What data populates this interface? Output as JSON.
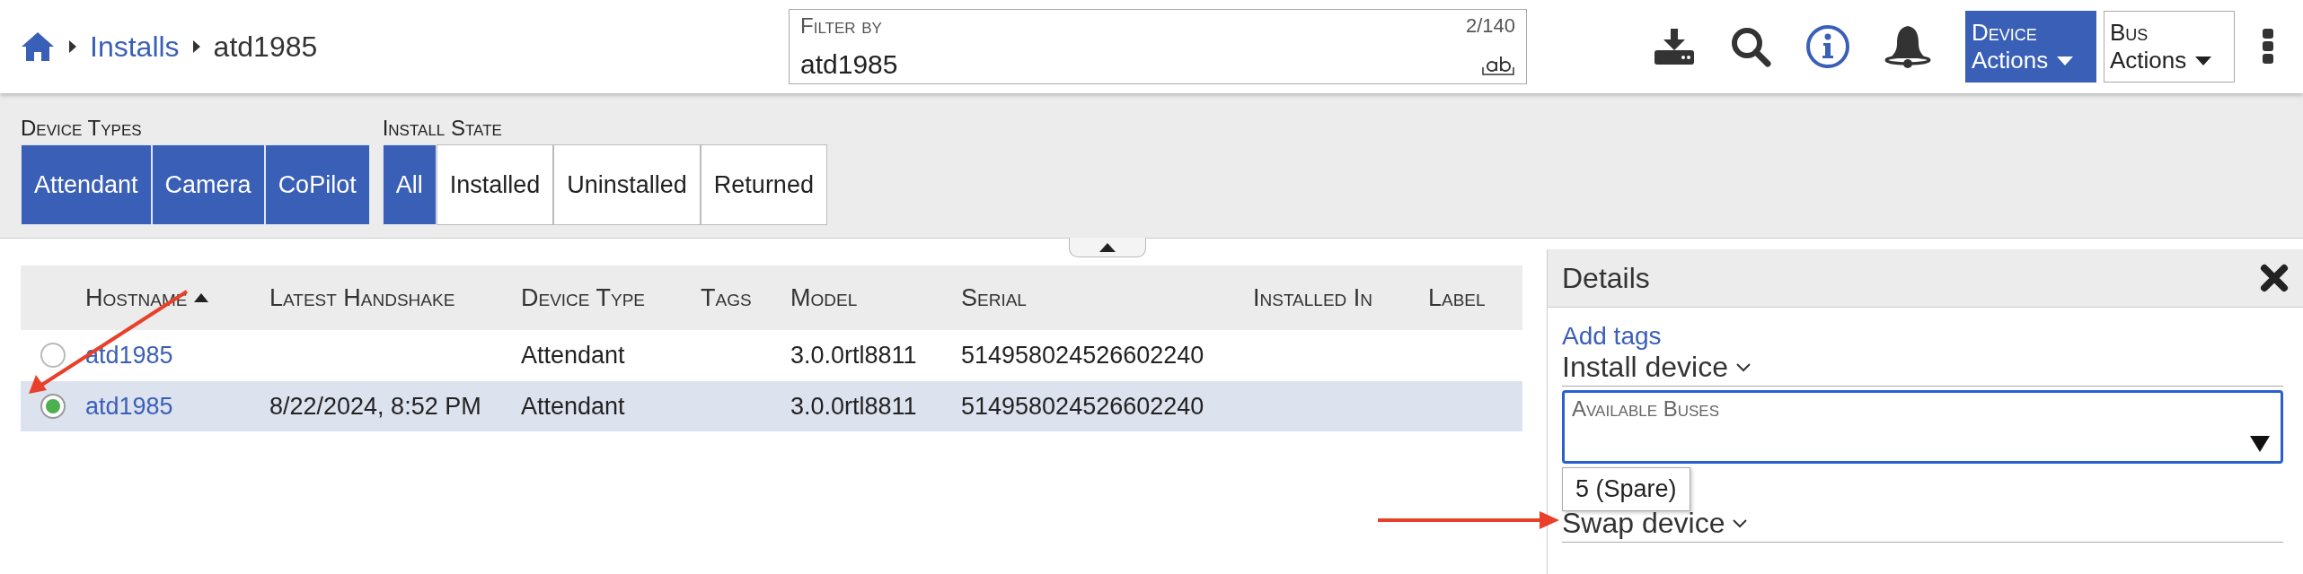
{
  "breadcrumb": [
    {
      "label": "Installs",
      "kind": "link"
    },
    {
      "label": "atd1985",
      "kind": "current"
    }
  ],
  "filter": {
    "label": "Filter by",
    "count": "2/140",
    "value": "atd1985"
  },
  "action_buttons": [
    {
      "line1": "Device",
      "line2": "Actions",
      "kind": "primary"
    },
    {
      "line1": "Bus",
      "line2": "Actions",
      "kind": "secondary"
    }
  ],
  "filter_groups": [
    {
      "label": "Device Types",
      "options": [
        {
          "label": "Attendant",
          "selected": true
        },
        {
          "label": "Camera",
          "selected": true
        },
        {
          "label": "CoPilot",
          "selected": true
        }
      ]
    },
    {
      "label": "Install State",
      "options": [
        {
          "label": "All",
          "selected": true
        },
        {
          "label": "Installed",
          "selected": false
        },
        {
          "label": "Uninstalled",
          "selected": false
        },
        {
          "label": "Returned",
          "selected": false
        }
      ]
    }
  ],
  "table": {
    "columns": [
      {
        "label": "Hostname",
        "sorted": true
      },
      {
        "label": "Latest Handshake",
        "sorted": false
      },
      {
        "label": "Device Type",
        "sorted": false
      },
      {
        "label": "Tags",
        "sorted": false
      },
      {
        "label": "Model",
        "sorted": false
      },
      {
        "label": "Serial",
        "sorted": false
      },
      {
        "label": "Installed In",
        "sorted": false
      },
      {
        "label": "Label",
        "sorted": false
      }
    ],
    "rows": [
      {
        "selected": false,
        "cells": [
          "atd1985",
          null,
          "Attendant",
          null,
          "3.0.0rtl8811",
          "514958024526602240",
          null,
          null
        ]
      },
      {
        "selected": true,
        "cells": [
          "atd1985",
          "8/22/2024, 8:52 PM",
          "Attendant",
          null,
          "3.0.0rtl8811",
          "514958024526602240",
          null,
          null
        ]
      }
    ]
  },
  "details": {
    "title": "Details",
    "add_tags": "Add tags",
    "install_section": "Install device",
    "bus_select": {
      "label": "Available Buses",
      "focused": true
    },
    "bus_options": [
      "5 (Spare)"
    ],
    "swap_section": "Swap device"
  }
}
